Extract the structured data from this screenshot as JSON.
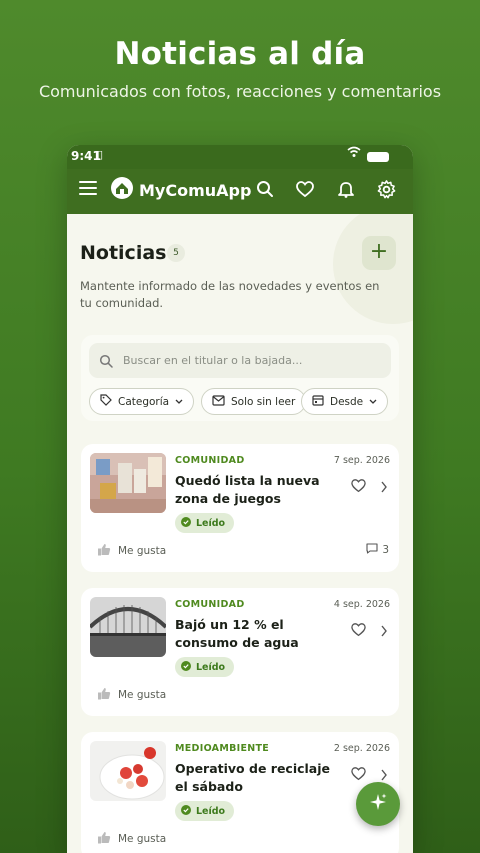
{
  "hero": {
    "title": "Noticias al día",
    "subtitle": "Comunicados con fotos, reacciones y comentarios"
  },
  "status_bar": {
    "time": "9:41"
  },
  "app_bar": {
    "app_name": "MyComuApp"
  },
  "page": {
    "title": "Noticias",
    "count": "5",
    "description": "Mantente informado de las novedades y eventos en tu comunidad."
  },
  "search": {
    "placeholder": "Buscar en el titular o la bajada..."
  },
  "filters": {
    "category_label": "Categoría",
    "unread_label": "Solo sin leer",
    "since_label": "Desde"
  },
  "news": [
    {
      "category": "COMUNIDAD",
      "date": "7 sep. 2026",
      "title": "Quedó lista la nueva zona de juegos",
      "status": "Leído",
      "like_label": "Me gusta",
      "comments": "3"
    },
    {
      "category": "COMUNIDAD",
      "date": "4 sep. 2026",
      "title": "Bajó un 12 % el consumo de agua",
      "status": "Leído",
      "like_label": "Me gusta"
    },
    {
      "category": "MEDIOAMBIENTE",
      "date": "2 sep. 2026",
      "title": "Operativo de reciclaje el sábado",
      "status": "Leído",
      "like_label": "Me gusta"
    }
  ],
  "colors": {
    "brand_green": "#3f6e20",
    "accent_green": "#4f8a1f",
    "read_badge_bg": "#e1ecd6",
    "background": "#f6f7ee"
  }
}
